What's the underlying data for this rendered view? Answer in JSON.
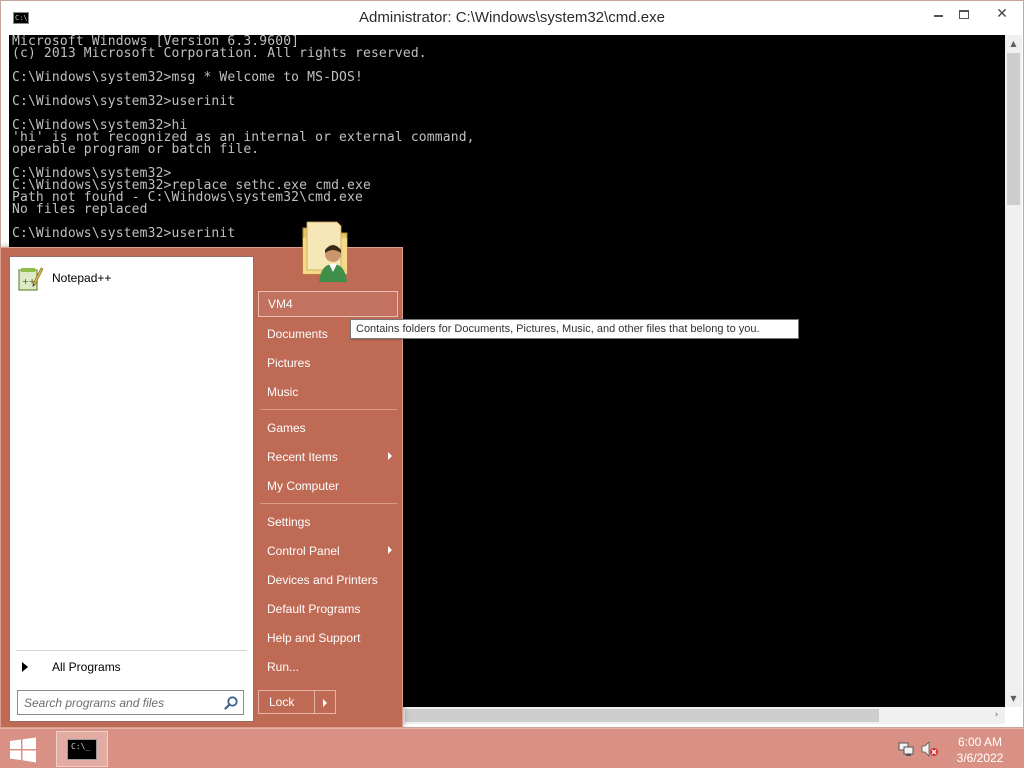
{
  "window": {
    "title": "Administrator: C:\\Windows\\system32\\cmd.exe",
    "icon_label": "C:\\"
  },
  "console_lines": [
    "Microsoft Windows [Version 6.3.9600]",
    "(c) 2013 Microsoft Corporation. All rights reserved.",
    "",
    "C:\\Windows\\system32>msg * Welcome to MS-DOS!",
    "",
    "C:\\Windows\\system32>userinit",
    "",
    "C:\\Windows\\system32>hi",
    "'hi' is not recognized as an internal or external command,",
    "operable program or batch file.",
    "",
    "C:\\Windows\\system32>",
    "C:\\Windows\\system32>replace sethc.exe cmd.exe",
    "Path not found - C:\\Windows\\system32\\cmd.exe",
    "No files replaced",
    "",
    "C:\\Windows\\system32>userinit"
  ],
  "start_menu": {
    "pinned": [
      {
        "label": "Notepad++",
        "icon": "notepad-plus-plus-icon"
      }
    ],
    "all_programs_label": "All Programs",
    "search_placeholder": "Search programs and files",
    "right_items": [
      {
        "label": "VM4",
        "name": "vm4",
        "submenu": false
      },
      {
        "label": "Documents",
        "name": "documents",
        "submenu": false
      },
      {
        "label": "Pictures",
        "name": "pictures",
        "submenu": false
      },
      {
        "label": "Music",
        "name": "music",
        "submenu": false
      },
      {
        "label": "Games",
        "name": "games",
        "submenu": false
      },
      {
        "label": "Recent Items",
        "name": "recent-items",
        "submenu": true
      },
      {
        "label": "My Computer",
        "name": "my-computer",
        "submenu": false
      },
      {
        "label": "Settings",
        "name": "settings",
        "submenu": false
      },
      {
        "label": "Control Panel",
        "name": "control-panel",
        "submenu": true
      },
      {
        "label": "Devices and Printers",
        "name": "devices-and-printers",
        "submenu": false
      },
      {
        "label": "Default Programs",
        "name": "default-programs",
        "submenu": false
      },
      {
        "label": "Help and Support",
        "name": "help-and-support",
        "submenu": false
      },
      {
        "label": "Run...",
        "name": "run",
        "submenu": false
      }
    ],
    "lock_label": "Lock"
  },
  "tooltip": "Contains folders for Documents, Pictures, Music, and other files that belong to you.",
  "taskbar": {
    "cmd_icon_label": "C:\\_",
    "clock_time": "6:00 AM",
    "clock_date": "3/6/2022"
  },
  "colors": {
    "start_menu_bg": "#bf6a55",
    "taskbar_bg": "#d89184",
    "console_bg": "#000000",
    "console_text": "#c0c0c0"
  }
}
